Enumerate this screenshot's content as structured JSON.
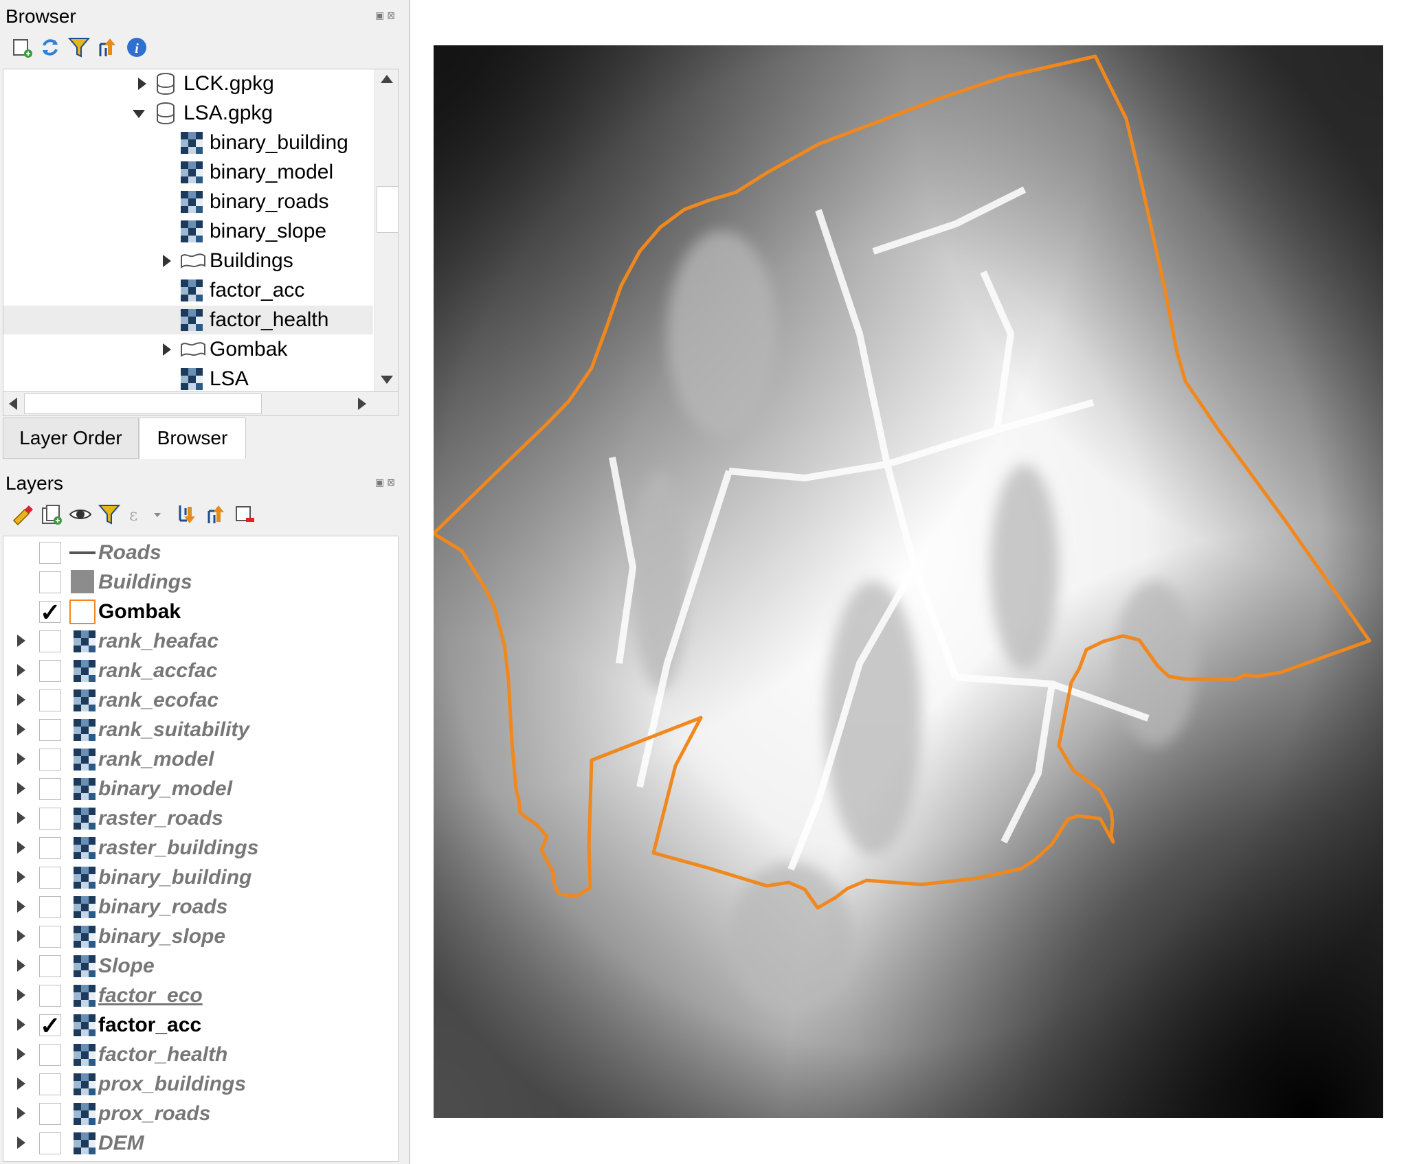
{
  "browser_panel": {
    "title": "Browser",
    "toolbar_icons": [
      "add-layer-icon",
      "refresh-icon",
      "filter-icon",
      "collapse-all-icon",
      "info-icon"
    ],
    "items": [
      {
        "label": "LCK.gpkg",
        "type": "geopackage",
        "expanded": false,
        "depth": 0
      },
      {
        "label": "LSA.gpkg",
        "type": "geopackage",
        "expanded": true,
        "depth": 0
      },
      {
        "label": "binary_building",
        "type": "raster",
        "depth": 1
      },
      {
        "label": "binary_model",
        "type": "raster",
        "depth": 1
      },
      {
        "label": "binary_roads",
        "type": "raster",
        "depth": 1
      },
      {
        "label": "binary_slope",
        "type": "raster",
        "depth": 1
      },
      {
        "label": "Buildings",
        "type": "polygon",
        "expanded": false,
        "depth": 1
      },
      {
        "label": "factor_acc",
        "type": "raster",
        "depth": 1
      },
      {
        "label": "factor_health",
        "type": "raster",
        "depth": 1,
        "selected": true
      },
      {
        "label": "Gombak",
        "type": "polygon",
        "expanded": false,
        "depth": 1
      },
      {
        "label": "LSA",
        "type": "raster",
        "depth": 1
      }
    ]
  },
  "tabs": [
    {
      "label": "Layer Order",
      "active": false
    },
    {
      "label": "Browser",
      "active": true
    }
  ],
  "layers_panel": {
    "title": "Layers",
    "toolbar_icons": [
      "style-icon",
      "add-group-icon",
      "visibility-icon",
      "filter-icon",
      "expression-filter-icon",
      "expand-all-icon",
      "collapse-all-icon",
      "remove-layer-icon"
    ],
    "layers": [
      {
        "label": "Roads",
        "type": "line",
        "checked": false,
        "expandable": false
      },
      {
        "label": "Buildings",
        "type": "fill",
        "checked": false,
        "expandable": false
      },
      {
        "label": "Gombak",
        "type": "outline",
        "checked": true,
        "expandable": false
      },
      {
        "label": "rank_heafac",
        "type": "raster",
        "checked": false,
        "expandable": true
      },
      {
        "label": "rank_accfac",
        "type": "raster",
        "checked": false,
        "expandable": true
      },
      {
        "label": "rank_ecofac",
        "type": "raster",
        "checked": false,
        "expandable": true
      },
      {
        "label": "rank_suitability",
        "type": "raster",
        "checked": false,
        "expandable": true
      },
      {
        "label": "rank_model",
        "type": "raster",
        "checked": false,
        "expandable": true
      },
      {
        "label": "binary_model",
        "type": "raster",
        "checked": false,
        "expandable": true
      },
      {
        "label": "raster_roads",
        "type": "raster",
        "checked": false,
        "expandable": true
      },
      {
        "label": "raster_buildings",
        "type": "raster",
        "checked": false,
        "expandable": true
      },
      {
        "label": "binary_building",
        "type": "raster",
        "checked": false,
        "expandable": true
      },
      {
        "label": "binary_roads",
        "type": "raster",
        "checked": false,
        "expandable": true
      },
      {
        "label": "binary_slope",
        "type": "raster",
        "checked": false,
        "expandable": true
      },
      {
        "label": "Slope",
        "type": "raster",
        "checked": false,
        "expandable": true
      },
      {
        "label": "factor_eco",
        "type": "raster",
        "checked": false,
        "expandable": true,
        "underline": true
      },
      {
        "label": "factor_acc",
        "type": "raster",
        "checked": true,
        "expandable": true
      },
      {
        "label": "factor_health",
        "type": "raster",
        "checked": false,
        "expandable": true
      },
      {
        "label": "prox_buildings",
        "type": "raster",
        "checked": false,
        "expandable": true
      },
      {
        "label": "prox_roads",
        "type": "raster",
        "checked": false,
        "expandable": true
      },
      {
        "label": "DEM",
        "type": "raster",
        "checked": false,
        "expandable": true
      }
    ]
  },
  "map": {
    "boundary_color": "#f0881e",
    "raster_style": "grayscale distance raster (white near roads/buildings, dark far away)"
  }
}
